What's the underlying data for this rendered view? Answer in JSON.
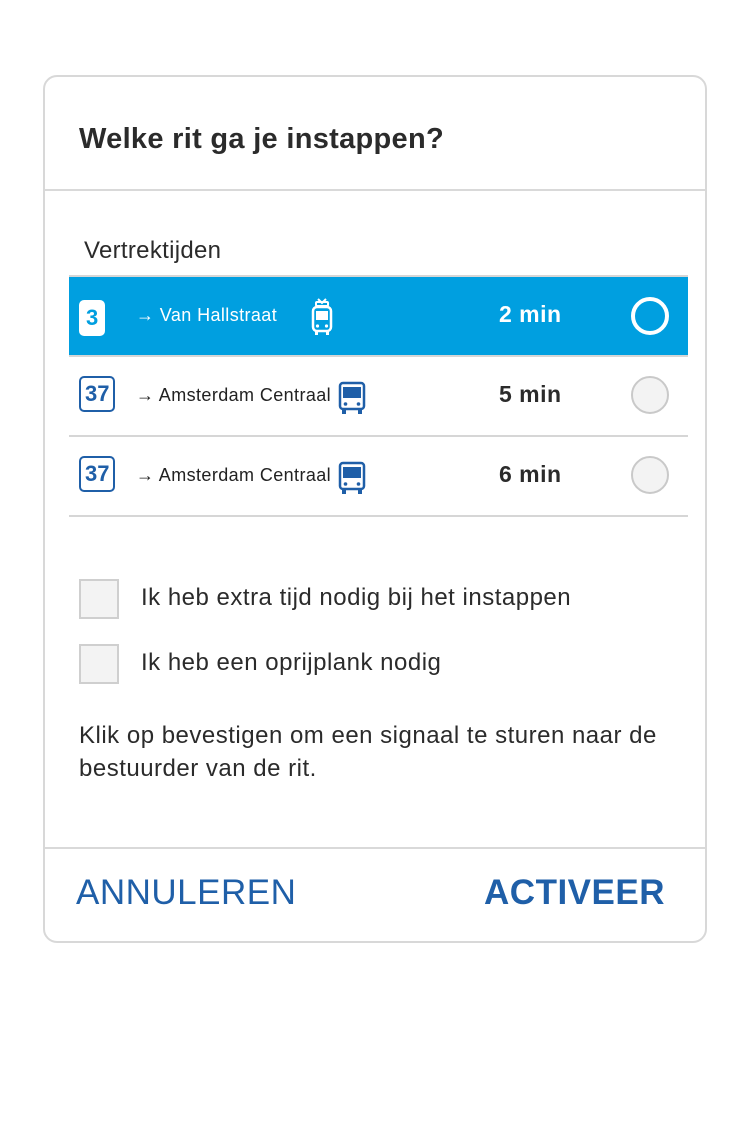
{
  "dialog": {
    "title": "Welke rit ga je instappen?",
    "section_label": "Vertrektijden",
    "departures": [
      {
        "line": "3",
        "destination": "→ Van Hallstraat",
        "vehicle": "tram-icon",
        "time": "2 min",
        "selected": true
      },
      {
        "line": "37",
        "destination": "→ Amsterdam Centraal",
        "vehicle": "bus-icon",
        "time": "5 min",
        "selected": false
      },
      {
        "line": "37",
        "destination": "→ Amsterdam Centraal",
        "vehicle": "bus-icon",
        "time": "6 min",
        "selected": false
      }
    ],
    "options": [
      {
        "label": "Ik heb extra tijd nodig bij het instappen",
        "checked": false
      },
      {
        "label": "Ik heb een oprijplank nodig",
        "checked": false
      }
    ],
    "info_text": "Klik op bevestigen om een signaal te sturen naar de bestuurder van de rit.",
    "cancel_label": "ANNULEREN",
    "activate_label": "ACTIVEER"
  },
  "colors": {
    "accent": "#009fe0",
    "brand_blue": "#1f5fa8",
    "border": "#d8d8d8"
  }
}
